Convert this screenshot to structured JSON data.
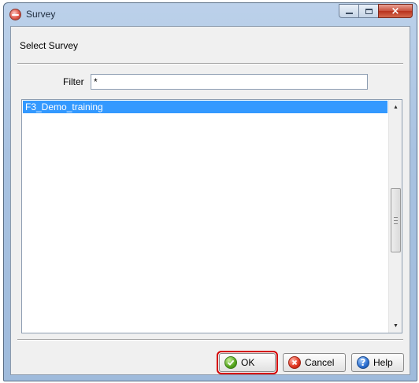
{
  "window": {
    "title": "Survey",
    "icon": "survey-app-icon",
    "controls": {
      "minimize": "minimize-icon",
      "maximize": "maximize-icon",
      "close": "×"
    }
  },
  "dialog": {
    "heading": "Select Survey",
    "filter": {
      "label": "Filter",
      "value": "*"
    },
    "list": {
      "items": [
        "F3_Demo_training"
      ],
      "selected": "F3_Demo_training"
    }
  },
  "buttons": {
    "ok": {
      "label": "OK",
      "icon": "checkmark-icon"
    },
    "cancel": {
      "label": "Cancel",
      "icon": "cancel-icon"
    },
    "help": {
      "label": "Help",
      "icon": "help-icon",
      "glyph": "?"
    }
  },
  "colors": {
    "selection": "#3399ff",
    "highlight_border": "#d40000"
  }
}
